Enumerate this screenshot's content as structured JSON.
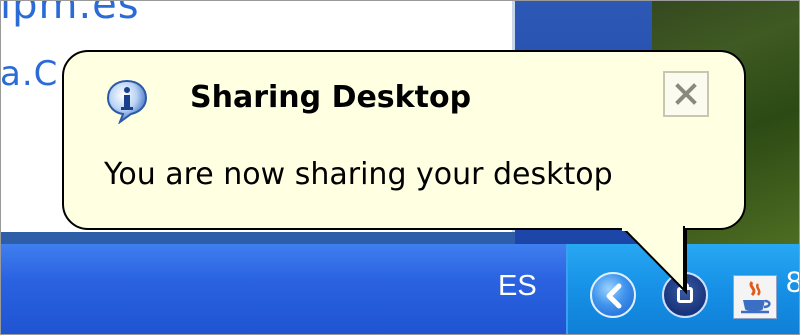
{
  "background_window": {
    "text_line_1": "ıpm.es",
    "text_line_2": "a.C"
  },
  "notification": {
    "title": "Sharing Desktop",
    "message": "You are now sharing your desktop",
    "icon": "info-icon",
    "close_icon": "close-icon"
  },
  "taskbar": {
    "language": "ES",
    "tray_icons": [
      "show-hidden-icons-chevron",
      "desktop-sharing-icon",
      "java-icon"
    ],
    "edge_glyph": "8"
  },
  "colors": {
    "balloon_bg": "#ffffe1",
    "taskbar_blue": "#2a62e0",
    "tray_blue": "#1690e6",
    "link_blue": "#2a6bd8"
  }
}
